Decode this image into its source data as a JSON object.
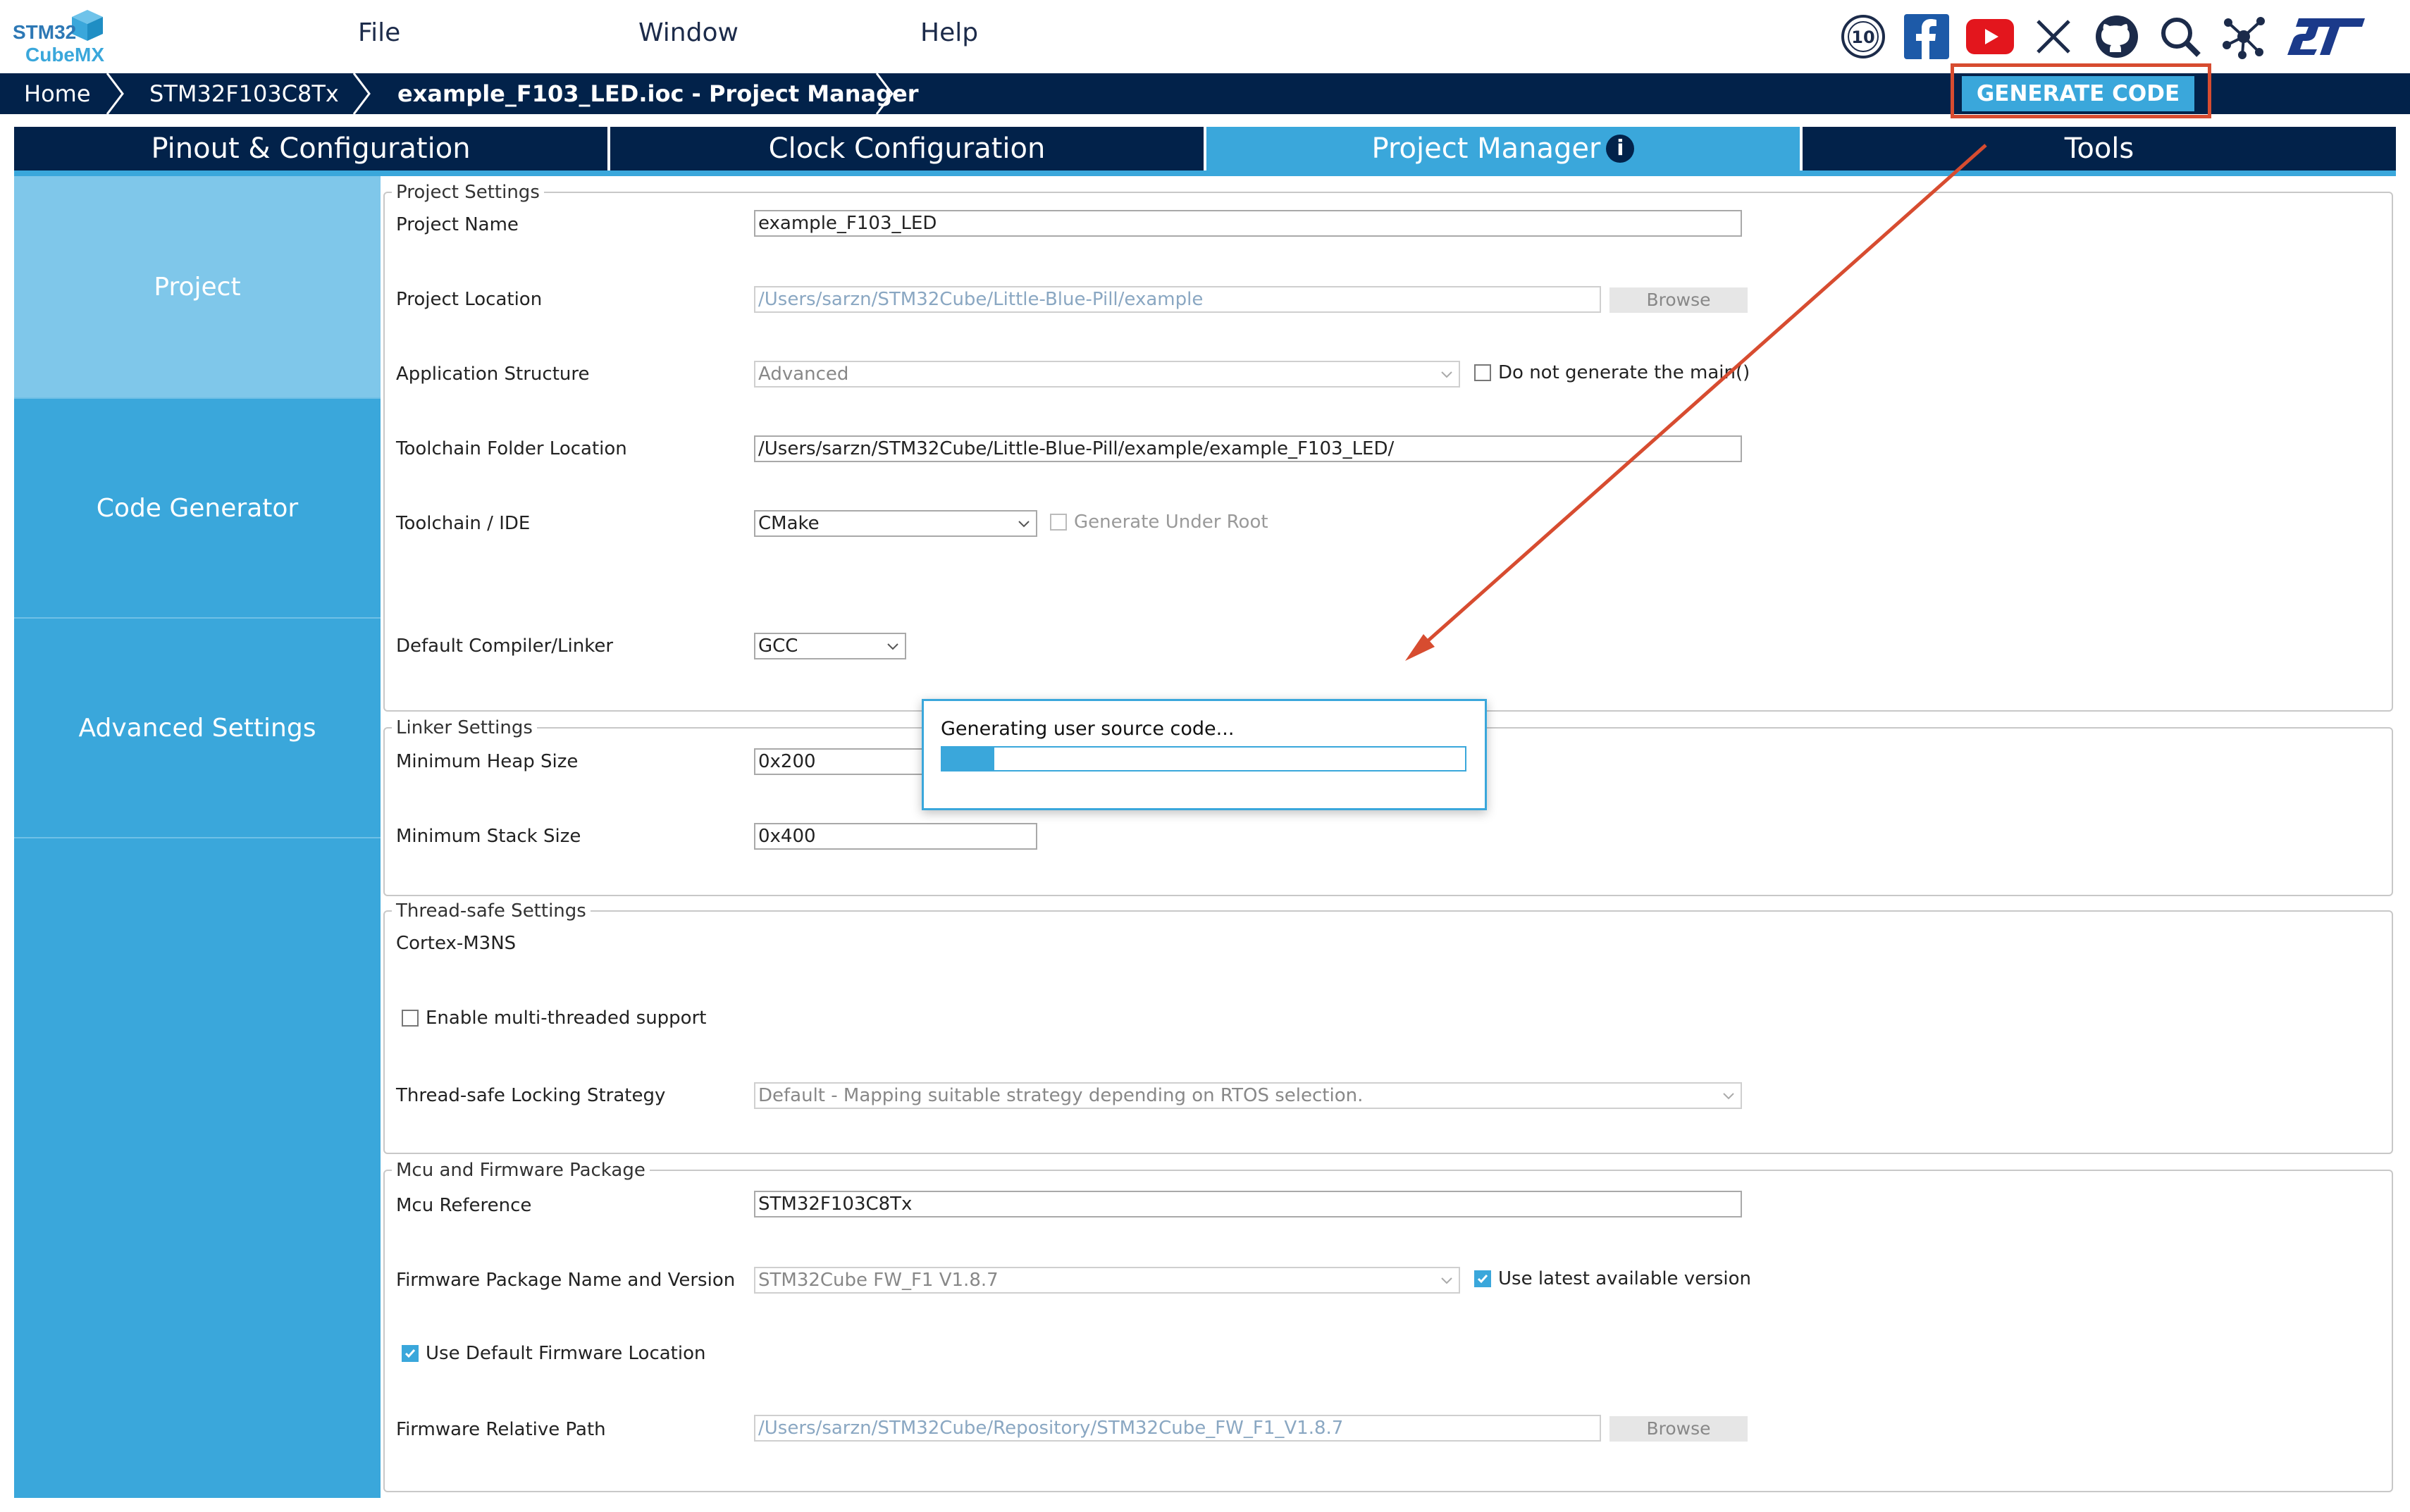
{
  "app": {
    "logo_line1": "STM32",
    "logo_line2": "CubeMX"
  },
  "menu": {
    "file": "File",
    "window": "Window",
    "help": "Help"
  },
  "social_icons": [
    "anniversary-10-icon",
    "facebook-icon",
    "youtube-icon",
    "x-icon",
    "github-icon",
    "search-community-icon",
    "network-icon",
    "st-logo-icon"
  ],
  "badge": {
    "anniversary": "10"
  },
  "breadcrumb": {
    "home": "Home",
    "mcu": "STM32F103C8Tx",
    "project": "example_F103_LED.ioc - Project Manager"
  },
  "generate_button": "GENERATE CODE",
  "tabs": {
    "pinout": "Pinout & Configuration",
    "clock": "Clock Configuration",
    "project_manager": "Project Manager",
    "tools": "Tools"
  },
  "sidebar": {
    "project": "Project",
    "code_generator": "Code Generator",
    "advanced": "Advanced Settings"
  },
  "project_settings": {
    "title": "Project Settings",
    "project_name_label": "Project Name",
    "project_name": "example_F103_LED",
    "project_location_label": "Project Location",
    "project_location": "/Users/sarzn/STM32Cube/Little-Blue-Pill/example",
    "browse": "Browse",
    "app_structure_label": "Application Structure",
    "app_structure": "Advanced",
    "no_main_label": "Do not generate the main()",
    "toolchain_folder_label": "Toolchain Folder Location",
    "toolchain_folder": "/Users/sarzn/STM32Cube/Little-Blue-Pill/example/example_F103_LED/",
    "toolchain_ide_label": "Toolchain / IDE",
    "toolchain_ide": "CMake",
    "gen_under_root_label": "Generate Under Root",
    "compiler_label": "Default Compiler/Linker",
    "compiler": "GCC"
  },
  "linker_settings": {
    "title": "Linker Settings",
    "heap_label": "Minimum Heap Size",
    "heap": "0x200",
    "stack_label": "Minimum Stack Size",
    "stack": "0x400"
  },
  "thread_settings": {
    "title": "Thread-safe Settings",
    "core": "Cortex-M3NS",
    "multithread_label": "Enable multi-threaded support",
    "strategy_label": "Thread-safe Locking Strategy",
    "strategy": "Default - Mapping suitable strategy depending on RTOS selection."
  },
  "firmware": {
    "title": "Mcu and Firmware Package",
    "mcu_ref_label": "Mcu Reference",
    "mcu_ref": "STM32F103C8Tx",
    "fw_name_label": "Firmware Package Name and Version",
    "fw_name": "STM32Cube FW_F1 V1.8.7",
    "latest_label": "Use latest available version",
    "default_loc_label": "Use Default Firmware Location",
    "rel_path_label": "Firmware Relative Path",
    "rel_path": "/Users/sarzn/STM32Cube/Repository/STM32Cube_FW_F1_V1.8.7",
    "browse": "Browse"
  },
  "dialog": {
    "message": "Generating user source code...",
    "progress": 0.1
  },
  "colors": {
    "navy": "#02224a",
    "accent": "#3aa7db",
    "highlight": "#d74c30"
  }
}
